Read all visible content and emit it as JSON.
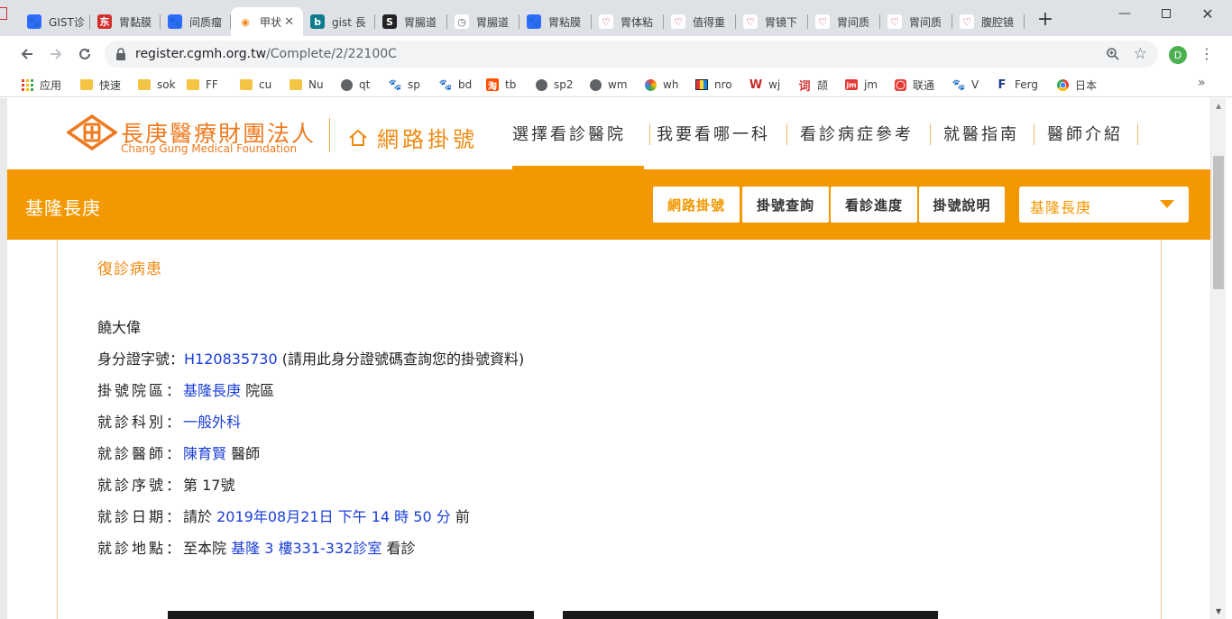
{
  "browser": {
    "tabs": [
      {
        "title": "GIST诊",
        "icon": "paw-icon"
      },
      {
        "title": "胃黏膜",
        "icon": "dongfang-icon"
      },
      {
        "title": "间质瘤",
        "icon": "paw-icon"
      },
      {
        "title": "甲状",
        "icon": "eye-icon",
        "active": true
      },
      {
        "title": "gist 長",
        "icon": "bing-icon"
      },
      {
        "title": "胃腸道",
        "icon": "s-icon"
      },
      {
        "title": "胃腸道",
        "icon": "globe-icon"
      },
      {
        "title": "胃粘膜",
        "icon": "paw-icon"
      },
      {
        "title": "胃体粘",
        "icon": "heart-icon"
      },
      {
        "title": "值得重",
        "icon": "heart-icon"
      },
      {
        "title": "胃镜下",
        "icon": "heart-icon"
      },
      {
        "title": "胃间质",
        "icon": "heart-icon"
      },
      {
        "title": "胃间质",
        "icon": "heart-icon"
      },
      {
        "title": "腹腔镜",
        "icon": "heart-icon"
      }
    ],
    "url_host": "register.cgmh.org.tw",
    "url_path": "/Complete/2/22100C",
    "profile_initial": "D",
    "bookmarks": [
      {
        "label": "应用",
        "icon": "apps-grid-icon"
      },
      {
        "label": "快速",
        "icon": "folder-icon"
      },
      {
        "label": "sok",
        "icon": "folder-icon"
      },
      {
        "label": "FF",
        "icon": "folder-icon"
      },
      {
        "label": "cu",
        "icon": "folder-icon"
      },
      {
        "label": "Nu",
        "icon": "folder-icon"
      },
      {
        "label": "qt",
        "icon": "globe-icon"
      },
      {
        "label": "sp",
        "icon": "paw-icon"
      },
      {
        "label": "bd",
        "icon": "paw-icon"
      },
      {
        "label": "tb",
        "icon": "taobao-icon"
      },
      {
        "label": "sp2",
        "icon": "globe-icon"
      },
      {
        "label": "wm",
        "icon": "globe-icon"
      },
      {
        "label": "wh",
        "icon": "pinwheel-icon"
      },
      {
        "label": "nro",
        "icon": "tv-icon"
      },
      {
        "label": "wj",
        "icon": "w-icon"
      },
      {
        "label": "颉",
        "icon": "ci-icon"
      },
      {
        "label": "jm",
        "icon": "jm-icon"
      },
      {
        "label": "联通",
        "icon": "unicom-icon"
      },
      {
        "label": "V",
        "icon": "paw-icon"
      },
      {
        "label": "Ferg",
        "icon": "ferg-icon"
      },
      {
        "label": "日本",
        "icon": "chrome-icon"
      }
    ]
  },
  "site": {
    "logo_cn": "長庚醫療財團法人",
    "logo_en": "Chang Gung Medical Foundation",
    "online_reg": "網路掛號",
    "nav": [
      "選擇看診醫院",
      "我要看哪一科",
      "看診病症參考",
      "就醫指南",
      "醫師介紹"
    ],
    "band_title": "基隆長庚",
    "band_buttons": [
      "網路掛號",
      "掛號查詢",
      "看診進度",
      "掛號說明"
    ],
    "hospital_select": "基隆長庚",
    "accent": "#f39800"
  },
  "result": {
    "heading": "復診病患",
    "patient_name": "饒大偉",
    "id_label": "身分證字號：",
    "id_value": "H120835730",
    "id_note": "(請用此身分證號碼查詢您的掛號資料)",
    "campus_label": "掛號院區：",
    "campus_value": "基隆長庚",
    "campus_suffix": "院區",
    "dept_label": "就診科別：",
    "dept_value": "一般外科",
    "doctor_label": "就診醫師：",
    "doctor_value": "陳育賢",
    "doctor_suffix": "醫師",
    "seq_label": "就診序號：",
    "seq_value": "第 17號",
    "date_label": "就診日期：",
    "date_prefix": "請於",
    "date_value": "2019年08月21日 下午 14 時 50 分",
    "date_suffix": "前",
    "place_label": "就診地點：",
    "place_prefix": "至本院",
    "place_value": "基隆 3 樓331-332診室",
    "place_suffix": "看診"
  }
}
